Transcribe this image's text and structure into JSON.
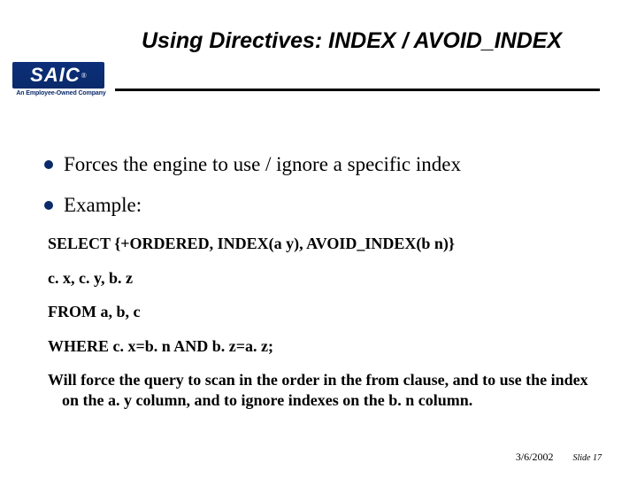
{
  "title": "Using Directives:  INDEX / AVOID_INDEX",
  "logo": {
    "text": "SAIC",
    "reg": "®",
    "tagline": "An Employee-Owned Company"
  },
  "bullets": [
    "Forces the engine to use / ignore a specific index",
    "Example:"
  ],
  "code": {
    "l1": "SELECT {+ORDERED, INDEX(a y), AVOID_INDEX(b n)}",
    "l2": "c. x, c. y, b. z",
    "l3": "FROM a, b, c",
    "l4": "WHERE c. x=b. n AND b. z=a. z;"
  },
  "explain": "Will force the query to scan in the order in the from clause, and to use the index on the a. y column, and to ignore indexes on the b. n column.",
  "footer": {
    "date": "3/6/2002",
    "slide": "Slide 17"
  }
}
